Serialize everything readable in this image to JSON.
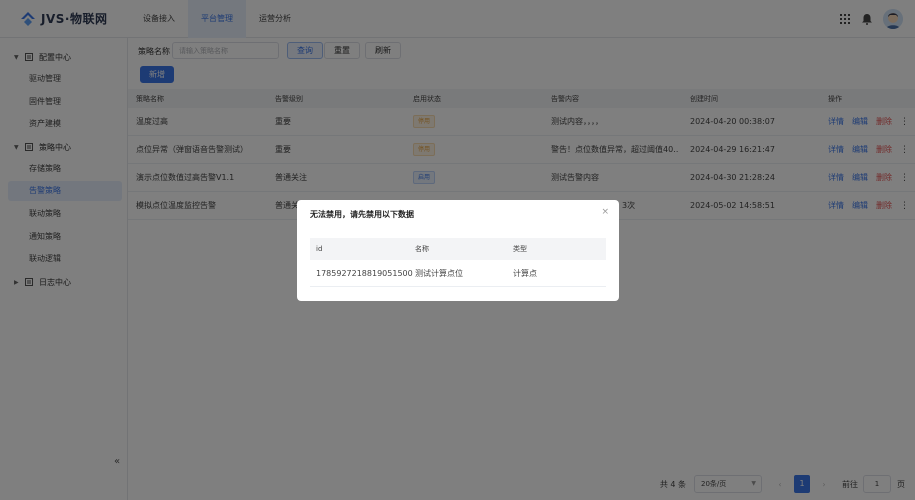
{
  "header": {
    "logo_text": "JVS·物联网",
    "nav": [
      "设备接入",
      "平台管理",
      "运营分析"
    ],
    "active_nav": 1
  },
  "sidebar": {
    "groups": [
      {
        "label": "配置中心",
        "expanded": true,
        "items": [
          "驱动管理",
          "固件管理",
          "资产建模"
        ]
      },
      {
        "label": "策略中心",
        "expanded": true,
        "items": [
          "存储策略",
          "告警策略",
          "联动策略",
          "通知策略",
          "联动逻辑"
        ]
      },
      {
        "label": "日志中心",
        "expanded": false,
        "items": []
      }
    ],
    "active_item": "告警策略",
    "collapse_glyph": "«"
  },
  "filter": {
    "label": "策略名称",
    "placeholder": "请输入策略名称",
    "query": "查询",
    "reset": "重置",
    "refresh": "刷新",
    "add": "新增"
  },
  "table": {
    "headers": [
      "策略名称",
      "告警级别",
      "启用状态",
      "告警内容",
      "创建时间",
      "操作"
    ],
    "rows": [
      {
        "name": "温度过高",
        "level": "重要",
        "status": "停用",
        "status_on": false,
        "content": "测试内容，，，，",
        "time": "2024-04-20 00:38:07"
      },
      {
        "name": "点位异常（弹窗语音告警测试）",
        "level": "重要",
        "status": "停用",
        "status_on": false,
        "content": "警告！点位数值异常，超过阈值40…",
        "time": "2024-04-29 16:21:47"
      },
      {
        "name": "演示点位数值过高告警V1.1",
        "level": "普通关注",
        "status": "启用",
        "status_on": true,
        "content": "测试告警内容",
        "time": "2024-04-30 21:28:24"
      },
      {
        "name": "模拟点位温度监控告警",
        "level": "普通关",
        "status": "",
        "status_on": false,
        "content": "3次",
        "time": "2024-05-02 14:58:51"
      }
    ],
    "actions": {
      "detail": "详情",
      "edit": "编辑",
      "delete": "删除",
      "more": "⋮"
    }
  },
  "pagination": {
    "total": "共 4 条",
    "page_size": "20条/页",
    "current_page": "1",
    "goto_label": "前往",
    "goto_value": "1",
    "page_suffix": "页"
  },
  "dialog": {
    "title": "无法禁用，请先禁用以下数据",
    "close": "×",
    "headers": [
      "id",
      "名称",
      "类型"
    ],
    "rows": [
      {
        "id": "1785927218819051500",
        "name": "测试计算点位",
        "type": "计算点"
      }
    ]
  },
  "colors": {
    "primary": "#3b76e8",
    "danger": "#e55353",
    "warning": "#e6a23c"
  }
}
